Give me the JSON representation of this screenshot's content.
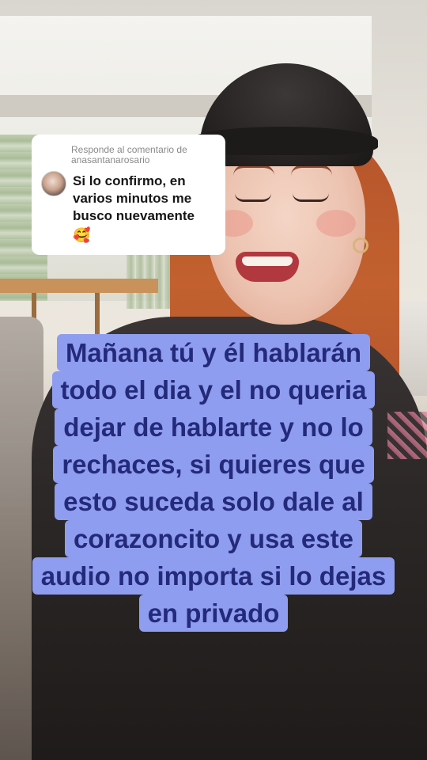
{
  "comment_reply": {
    "header": "Responde al comentario de\nanasantanarosario",
    "text": "Si lo confirmo, en varios minutos me busco nuevamente",
    "emoji": "🥰",
    "avatar_icon": "user-avatar-photo"
  },
  "caption": {
    "lines": [
      "Mañana tú y él hablarán",
      "todo el dia y el no queria",
      "dejar de hablarte y no lo",
      "rechaces, si quieres que",
      "esto suceda solo dale al",
      "corazoncito y usa este",
      "audio no importa si lo dejas",
      "en privado"
    ],
    "background_color": "#8f9df0",
    "text_color": "#242a7a"
  }
}
